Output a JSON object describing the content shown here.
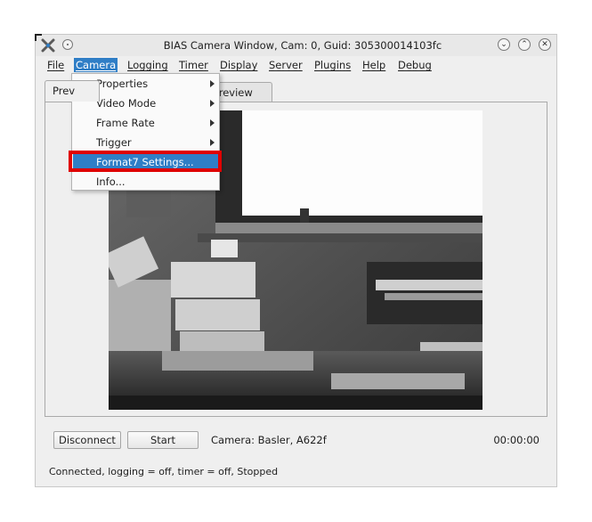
{
  "window": {
    "title": "BIAS Camera Window, Cam: 0, Guid: 305300014103fc",
    "app_icon": "bias-app-icon",
    "buttons": [
      "minimize-icon",
      "maximize-icon",
      "close-icon"
    ]
  },
  "menubar": {
    "items": [
      "File",
      "Camera",
      "Logging",
      "Timer",
      "Display",
      "Server",
      "Plugins",
      "Help",
      "Debug"
    ],
    "active": "Camera"
  },
  "camera_menu": {
    "items": [
      {
        "label": "Properties",
        "submenu": true
      },
      {
        "label": "Video Mode",
        "submenu": true
      },
      {
        "label": "Frame Rate",
        "submenu": true
      },
      {
        "label": "Trigger",
        "submenu": true
      },
      {
        "label": "Format7 Settings...",
        "submenu": false,
        "highlighted": true
      },
      {
        "label": "Info...",
        "submenu": false
      }
    ]
  },
  "tabs": {
    "first_visible": "Prev",
    "second_visible": "Preview"
  },
  "controls": {
    "disconnect_label": "Disconnect",
    "start_label": "Start",
    "camera_info": "Camera:  Basler,  A622f",
    "timer": "00:00:00"
  },
  "status_text": "Connected, logging = off, timer = off, Stopped",
  "colors": {
    "accent": "#2f7ec6",
    "highlight_box": "#e00000",
    "window_bg": "#efefef"
  }
}
